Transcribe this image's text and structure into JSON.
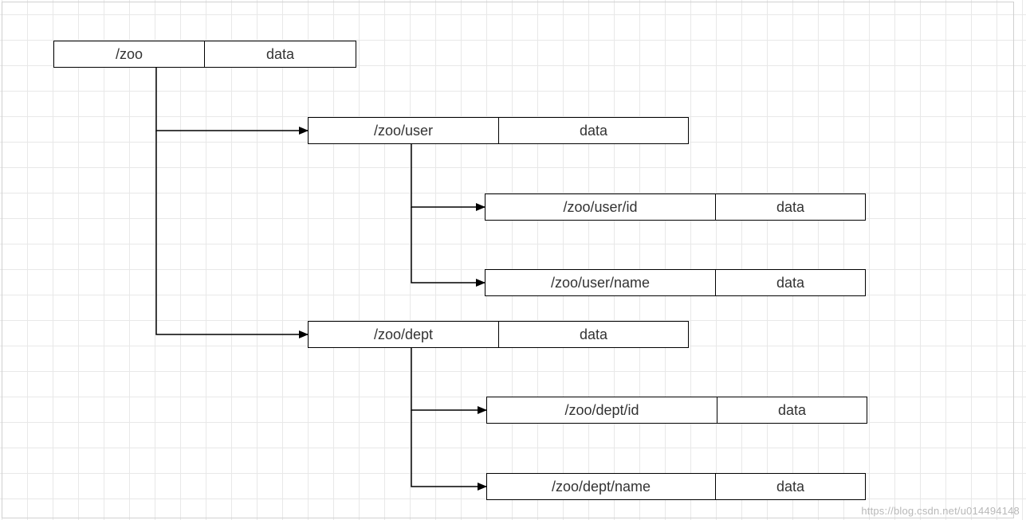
{
  "diagram": {
    "nodes": {
      "root": {
        "path": "/zoo",
        "value": "data"
      },
      "user": {
        "path": "/zoo/user",
        "value": "data"
      },
      "user_id": {
        "path": "/zoo/user/id",
        "value": "data"
      },
      "user_name": {
        "path": "/zoo/user/name",
        "value": "data"
      },
      "dept": {
        "path": "/zoo/dept",
        "value": "data"
      },
      "dept_id": {
        "path": "/zoo/dept/id",
        "value": "data"
      },
      "dept_name": {
        "path": "/zoo/dept/name",
        "value": "data"
      }
    },
    "edges": [
      {
        "from": "root",
        "to": "user"
      },
      {
        "from": "root",
        "to": "dept"
      },
      {
        "from": "user",
        "to": "user_id"
      },
      {
        "from": "user",
        "to": "user_name"
      },
      {
        "from": "dept",
        "to": "dept_id"
      },
      {
        "from": "dept",
        "to": "dept_name"
      }
    ]
  },
  "watermark": "https://blog.csdn.net/u014494148"
}
